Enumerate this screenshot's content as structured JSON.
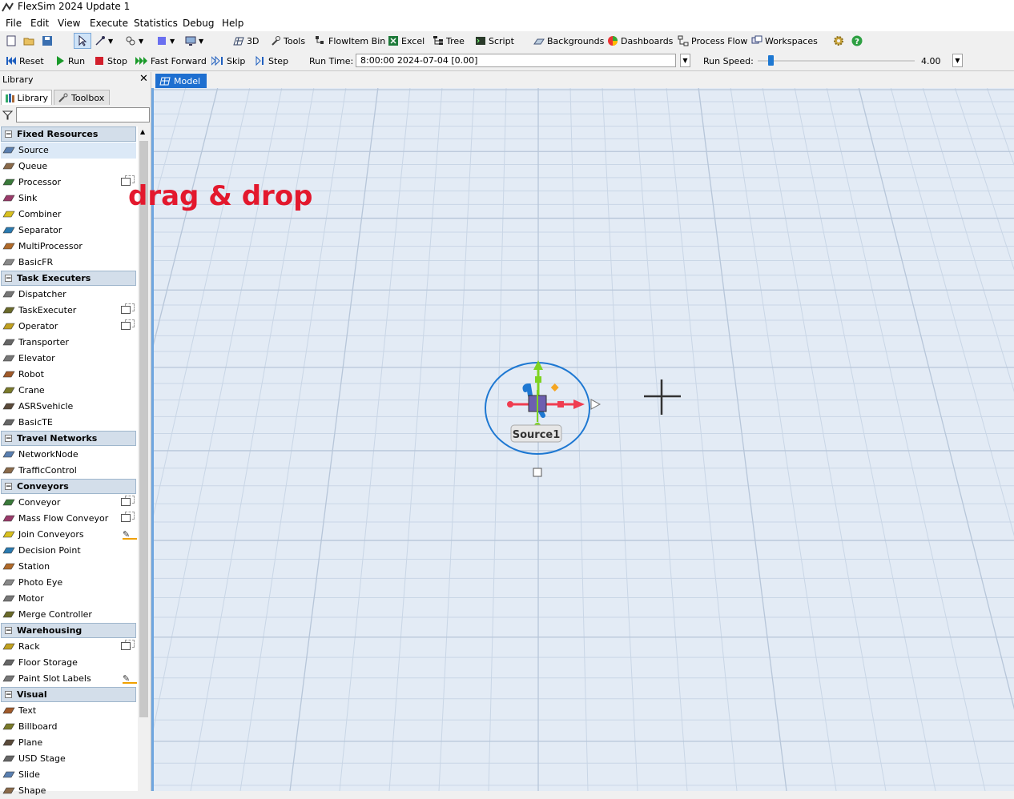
{
  "app": {
    "title": "FlexSim 2024 Update 1"
  },
  "menu": [
    "File",
    "Edit",
    "View",
    "Execute",
    "Statistics",
    "Debug",
    "Help"
  ],
  "toolbar": {
    "3d": "3D",
    "tools": "Tools",
    "flowitem_bin": "FlowItem Bin",
    "excel": "Excel",
    "tree": "Tree",
    "script": "Script",
    "backgrounds": "Backgrounds",
    "dashboards": "Dashboards",
    "process_flow": "Process Flow",
    "workspaces": "Workspaces"
  },
  "runbar": {
    "reset": "Reset",
    "run": "Run",
    "stop": "Stop",
    "fast_forward": "Fast Forward",
    "skip": "Skip",
    "step": "Step",
    "run_time_label": "Run Time:",
    "run_time_value": "8:00:00  2024-07-04  [0.00]",
    "run_speed_label": "Run Speed:",
    "run_speed_value": "4.00"
  },
  "library": {
    "title": "Library",
    "tabs": [
      "Library",
      "Toolbox"
    ],
    "sections": [
      {
        "name": "Fixed Resources",
        "items": [
          "Source",
          "Queue",
          "Processor",
          "Sink",
          "Combiner",
          "Separator",
          "MultiProcessor",
          "BasicFR"
        ]
      },
      {
        "name": "Task Executers",
        "items": [
          "Dispatcher",
          "TaskExecuter",
          "Operator",
          "Transporter",
          "Elevator",
          "Robot",
          "Crane",
          "ASRSvehicle",
          "BasicTE"
        ]
      },
      {
        "name": "Travel Networks",
        "items": [
          "NetworkNode",
          "TrafficControl"
        ]
      },
      {
        "name": "Conveyors",
        "items": [
          "Conveyor",
          "Mass Flow Conveyor",
          "Join Conveyors",
          "Decision Point",
          "Station",
          "Photo Eye",
          "Motor",
          "Merge Controller"
        ]
      },
      {
        "name": "Warehousing",
        "items": [
          "Rack",
          "Floor Storage",
          "Paint Slot Labels"
        ]
      },
      {
        "name": "Visual",
        "items": [
          "Text",
          "Billboard",
          "Plane",
          "USD Stage",
          "Slide",
          "Shape"
        ]
      }
    ]
  },
  "model": {
    "tab": "Model",
    "object_label": "Source1"
  },
  "annotation": {
    "text": "drag & drop"
  },
  "colors": {
    "accent": "#1e6fd0",
    "annotation": "#e3182d",
    "section_bg": "#d3deea",
    "grid_bg": "#e3ebf5"
  }
}
